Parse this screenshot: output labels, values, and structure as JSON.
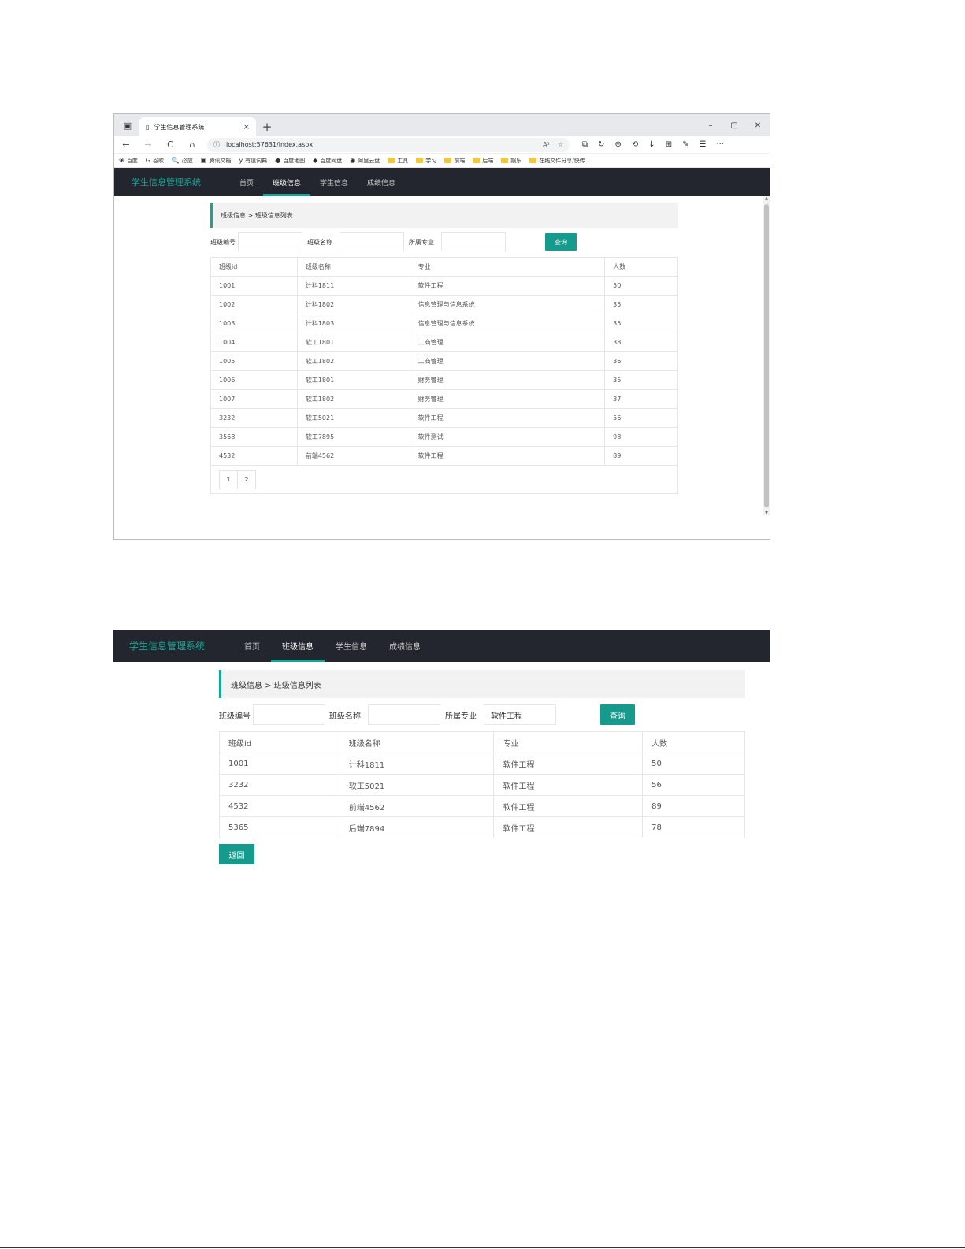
{
  "browser": {
    "tab_title": "学生信息管理系统",
    "tab_close": "×",
    "new_tab": "+",
    "window_controls": [
      "–",
      "▢",
      "✕"
    ],
    "url": "localhost:57631/index.aspx",
    "info_icon": "ⓘ",
    "read_aloud": "A¹",
    "nav_icons": [
      "←",
      "→",
      "C",
      "⌂"
    ],
    "tool_icons": [
      "⧉",
      "↻",
      "⊕",
      "⟲",
      "↓",
      "⊞",
      "✎",
      "☰",
      "···"
    ],
    "bookmarks": [
      {
        "icon": "❀",
        "label": "百度",
        "kind": "site"
      },
      {
        "icon": "G",
        "label": "谷歌",
        "kind": "site"
      },
      {
        "icon": "🔍",
        "label": "必应",
        "kind": "site"
      },
      {
        "icon": "▣",
        "label": "腾讯文档",
        "kind": "site"
      },
      {
        "icon": "y",
        "label": "有道词典",
        "kind": "site"
      },
      {
        "icon": "●",
        "label": "百度地图",
        "kind": "site"
      },
      {
        "icon": "◆",
        "label": "百度网盘",
        "kind": "site"
      },
      {
        "icon": "◉",
        "label": "阿里云盘",
        "kind": "site"
      },
      {
        "icon": "",
        "label": "工具",
        "kind": "folder"
      },
      {
        "icon": "",
        "label": "学习",
        "kind": "folder"
      },
      {
        "icon": "",
        "label": "前端",
        "kind": "folder"
      },
      {
        "icon": "",
        "label": "后端",
        "kind": "folder"
      },
      {
        "icon": "",
        "label": "娱乐",
        "kind": "folder"
      },
      {
        "icon": "",
        "label": "在线文件分享/快传...",
        "kind": "folder"
      }
    ]
  },
  "app": {
    "brand": "学生信息管理系统",
    "nav": [
      "首页",
      "班级信息",
      "学生信息",
      "成绩信息"
    ],
    "active_nav_index": 1,
    "breadcrumb": "班级信息 > 班级信息列表",
    "filters": {
      "class_id_label": "班级编号",
      "class_name_label": "班级名称",
      "major_label": "所属专业",
      "search_button": "查询"
    },
    "columns": [
      "班级id",
      "班级名称",
      "专业",
      "人数"
    ]
  },
  "screen1": {
    "filter_values": {
      "class_id": "",
      "class_name": "",
      "major": ""
    },
    "rows": [
      [
        "1001",
        "计科1811",
        "软件工程",
        "50"
      ],
      [
        "1002",
        "计科1802",
        "信息管理与信息系统",
        "35"
      ],
      [
        "1003",
        "计科1803",
        "信息管理与信息系统",
        "35"
      ],
      [
        "1004",
        "软工1801",
        "工商管理",
        "38"
      ],
      [
        "1005",
        "软工1802",
        "工商管理",
        "36"
      ],
      [
        "1006",
        "软工1801",
        "财务管理",
        "35"
      ],
      [
        "1007",
        "软工1802",
        "财务管理",
        "37"
      ],
      [
        "3232",
        "软工5021",
        "软件工程",
        "56"
      ],
      [
        "3568",
        "软工7895",
        "软件测试",
        "98"
      ],
      [
        "4532",
        "前端4562",
        "软件工程",
        "89"
      ]
    ],
    "pages": [
      "1",
      "2"
    ]
  },
  "screen2": {
    "filter_values": {
      "class_id": "",
      "class_name": "",
      "major": "软件工程"
    },
    "rows": [
      [
        "1001",
        "计科1811",
        "软件工程",
        "50"
      ],
      [
        "3232",
        "软工5021",
        "软件工程",
        "56"
      ],
      [
        "4532",
        "前端4562",
        "软件工程",
        "89"
      ],
      [
        "5365",
        "后端7894",
        "软件工程",
        "78"
      ]
    ],
    "back_button": "返回"
  }
}
